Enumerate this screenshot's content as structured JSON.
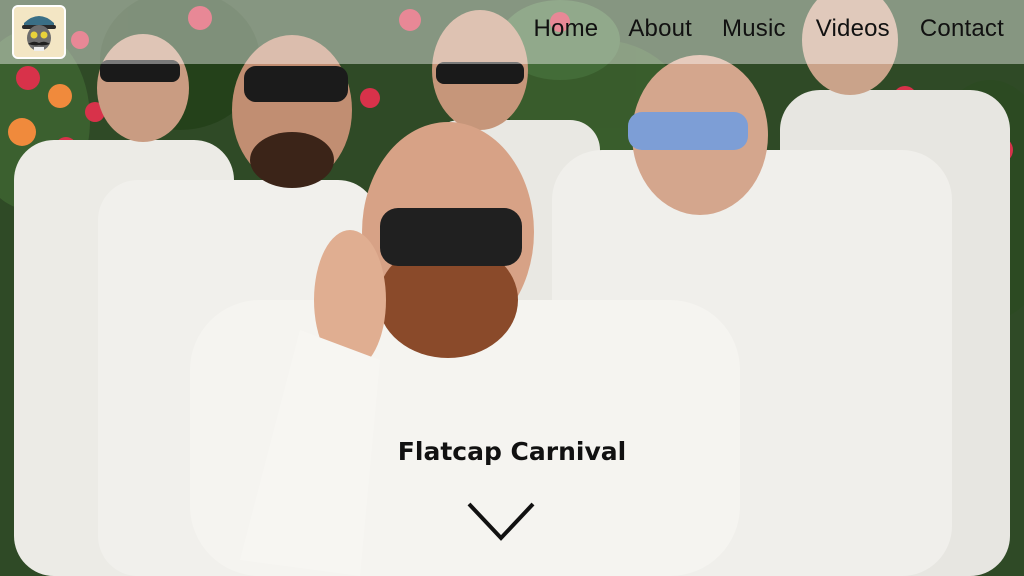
{
  "header": {
    "logo_icon": "mustache-skull-logo-icon",
    "nav": [
      {
        "label": "Home"
      },
      {
        "label": "About"
      },
      {
        "label": "Music"
      },
      {
        "label": "Videos"
      },
      {
        "label": "Contact"
      }
    ]
  },
  "hero": {
    "band_name": "Flatcap Carnival",
    "scroll_icon": "chevron-down-icon",
    "background_image": "band-photo",
    "colors": {
      "foliage": "#2f4a26",
      "flowers": "#d8324a",
      "shirts": "#eeeeea",
      "nav_overlay": "rgba(255,255,255,0.42)",
      "text": "#111111"
    }
  }
}
